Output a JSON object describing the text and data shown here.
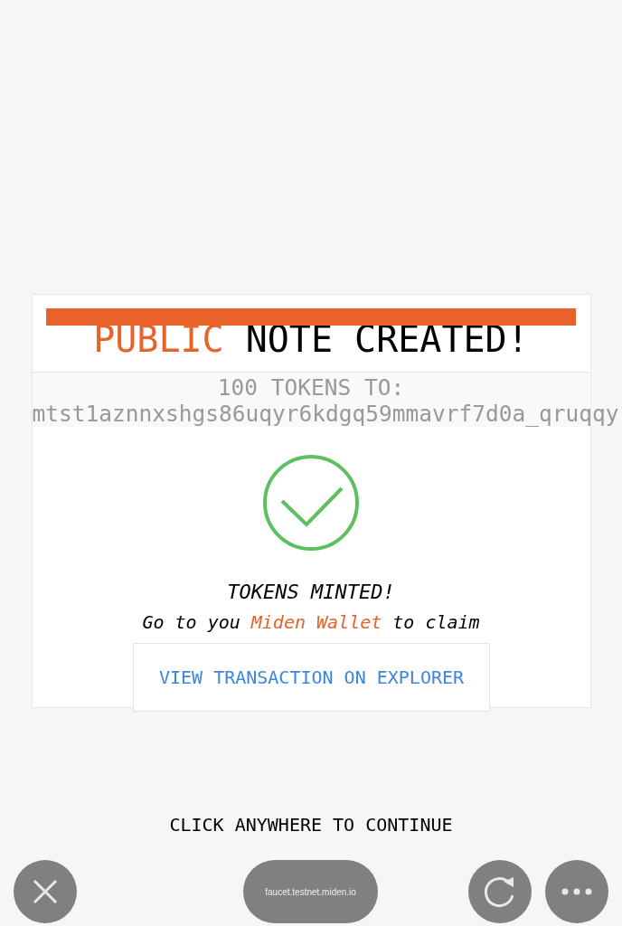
{
  "dialog": {
    "title_parts": [
      {
        "kind": "accent",
        "text": "PUBLIC"
      },
      {
        "kind": "plain",
        "text": "NOTE CREATED!"
      }
    ],
    "amount": "100 TOKENS TO:",
    "address": "mtst1aznnxshgs86uqyr6kdgq59mmavrf7d0a_qruqqy",
    "status": "TOKENS MINTED!",
    "claim_parts": [
      {
        "kind": "plain",
        "text": "Go to you"
      },
      {
        "kind": "link",
        "text": "Miden Wallet"
      },
      {
        "kind": "plain",
        "text": "to claim"
      }
    ],
    "button": "VIEW TRANSACTION ON EXPLORER"
  },
  "hint": "CLICK ANYWHERE TO CONTINUE",
  "browser_bar": {
    "url": "faucet.testnet.miden.io"
  }
}
